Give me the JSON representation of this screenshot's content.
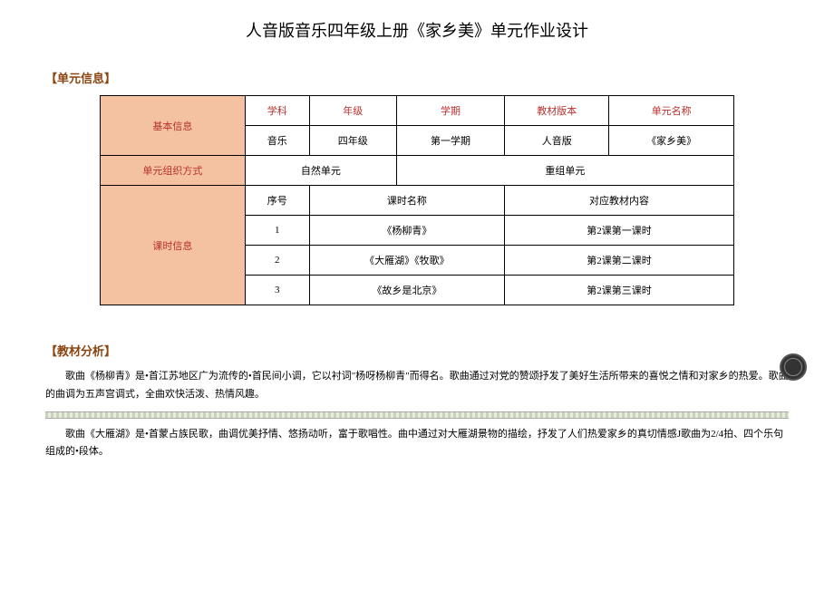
{
  "title": "人音版音乐四年级上册《家乡美》单元作业设计",
  "section1": {
    "label": "【单元信息】"
  },
  "table": {
    "basic_info_label": "基本信息",
    "headers": {
      "subject": "学科",
      "grade": "年级",
      "semester": "学期",
      "textbook_version": "教材版本",
      "unit_name": "单元名称"
    },
    "basic_values": {
      "subject": "音乐",
      "grade": "四年级",
      "semester": "第一学期",
      "textbook_version": "人音版",
      "unit_name": "《家乡美》"
    },
    "org_label": "单元组织方式",
    "org_value1": "自然单元",
    "org_value2": "重组单元",
    "lesson_info_label": "课时信息",
    "lesson_headers": {
      "seq": "序号",
      "name": "课时名称",
      "content": "对应教材内容"
    },
    "lessons": [
      {
        "seq": "1",
        "name": "《杨柳青》",
        "content": "第2课第一课时"
      },
      {
        "seq": "2",
        "name": "《大雁湖》《牧歌》",
        "content": "第2课第二课时"
      },
      {
        "seq": "3",
        "name": "《故乡是北京》",
        "content": "第2课第三课时"
      }
    ]
  },
  "section2": {
    "label": "【教材分析】",
    "para1": "歌曲《杨柳青》是•首江苏地区广为流传的•首民间小调，它以衬词\"杨呀杨柳青\"而得名。歌曲通过对党的赞颂抒发了美好生活所带来的喜悦之情和对家乡的热爱。歌曲的曲调为五声宫调式，全曲欢快活泼、热情风趣。",
    "para2": "歌曲《大雁湖》是•首蒙占族民歌，曲调优美抒情、悠扬动听，富于歌唱性。曲中通过对大雁湖景物的描绘，抒发了人们热爱家乡的真切情感J歌曲为2/4拍、四个乐句组成的•段体。"
  }
}
